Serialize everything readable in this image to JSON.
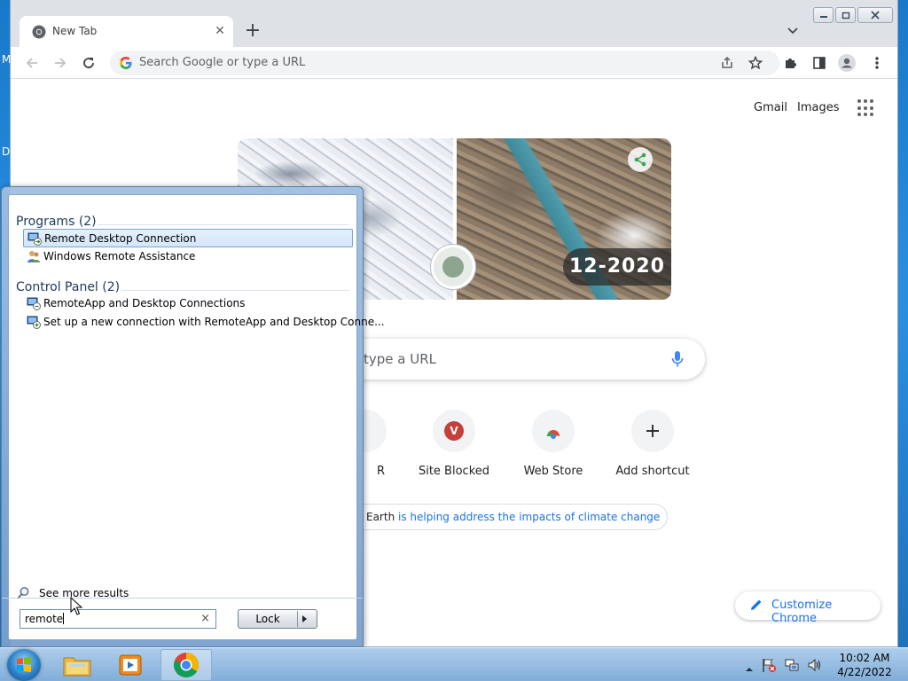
{
  "desktop": {
    "edge_letters": [
      "M",
      "D"
    ]
  },
  "browser": {
    "tab": {
      "title": "New Tab"
    },
    "omnibox": {
      "placeholder": "Search Google or type a URL"
    },
    "ntp": {
      "top_links": [
        "Gmail",
        "Images"
      ],
      "doodle": {
        "date_label": "12-2020"
      },
      "search_placeholder_visible": "type a URL",
      "shortcuts": [
        {
          "label": "R",
          "icon": "partially-hidden-icon"
        },
        {
          "label": "Site Blocked",
          "icon": "letter-v-icon",
          "letter": "V"
        },
        {
          "label": "Web Store",
          "icon": "chrome-web-store-icon"
        },
        {
          "label": "Add shortcut",
          "icon": "plus-icon"
        }
      ],
      "earth_text": "Earth",
      "earth_link": "is helping address the impacts of climate change",
      "customize_label": "Customize Chrome"
    }
  },
  "start_menu": {
    "sections": [
      {
        "header": "Programs (2)",
        "items": [
          {
            "label": "Remote Desktop Connection",
            "selected": true
          },
          {
            "label": "Windows Remote Assistance",
            "selected": false
          }
        ]
      },
      {
        "header": "Control Panel (2)",
        "items": [
          {
            "label": "RemoteApp and Desktop Connections",
            "selected": false
          },
          {
            "label": "Set up a new connection with RemoteApp and Desktop Conne...",
            "selected": false
          }
        ]
      }
    ],
    "see_more": "See more results",
    "search": {
      "value": "remote",
      "clear_glyph": "×"
    },
    "lock_button": "Lock"
  },
  "taskbar": {
    "clock": {
      "time": "10:02 AM",
      "date": "4/22/2022"
    }
  },
  "colors": {
    "accent_blue": "#1a73e8",
    "selected_item_border": "#7da2ce",
    "site_blocked_icon": "#c5403a"
  }
}
